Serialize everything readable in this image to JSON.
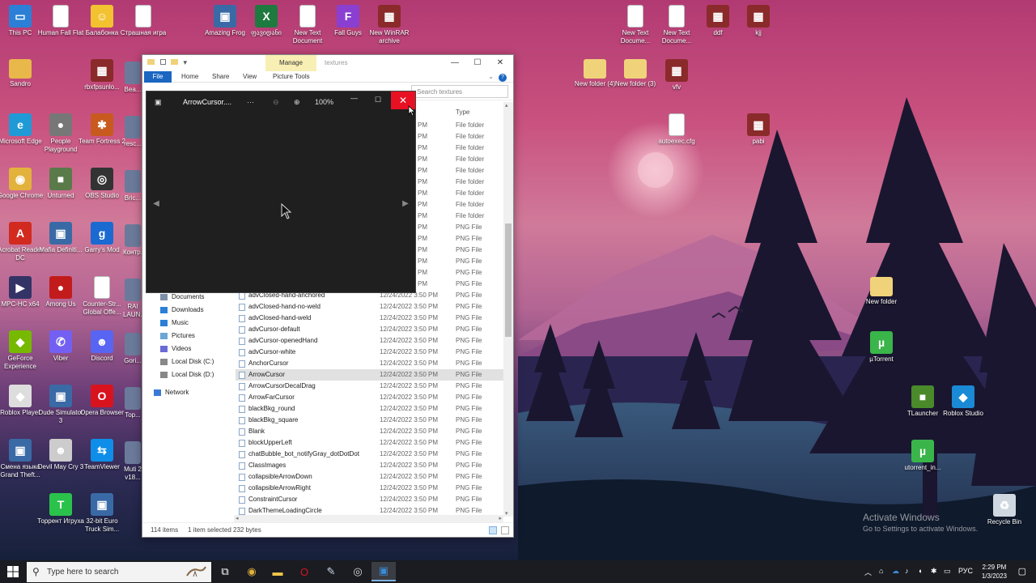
{
  "desktop": {
    "icons_left": [
      {
        "label": "This PC",
        "color": "#2b7fd6",
        "glyph": "▭"
      },
      {
        "label": "Human Fall Flat",
        "color": "#ffffff",
        "glyph": ""
      },
      {
        "label": "Балабонка",
        "color": "#f2c230",
        "glyph": "☺"
      },
      {
        "label": "Страшная игра",
        "color": "#ffffff",
        "glyph": ""
      },
      {
        "label": "Sandro",
        "color": "#e8b84a",
        "glyph": ""
      },
      {
        "label": "rbxfpsunlo...",
        "color": "#8a2a2a",
        "glyph": "▦"
      },
      {
        "label": "Microsoft Edge",
        "color": "#1f9ad6",
        "glyph": "e"
      },
      {
        "label": "People Playground",
        "color": "#777777",
        "glyph": "●"
      },
      {
        "label": "Team Fortress 2",
        "color": "#c85a1f",
        "glyph": "✱"
      },
      {
        "label": "Google Chrome",
        "color": "#e3b23c",
        "glyph": "◉"
      },
      {
        "label": "Unturned",
        "color": "#5a7a4a",
        "glyph": "■"
      },
      {
        "label": "OBS Studio",
        "color": "#333333",
        "glyph": "◎"
      },
      {
        "label": "Acrobat Reader DC",
        "color": "#d22a1f",
        "glyph": "A"
      },
      {
        "label": "Mafia Definiti...",
        "color": "#3a6aa6",
        "glyph": "▣"
      },
      {
        "label": "Garry's Mod",
        "color": "#1a6ad1",
        "glyph": "g"
      },
      {
        "label": "MPC-HC x64",
        "color": "#333366",
        "glyph": "▶"
      },
      {
        "label": "Among Us",
        "color": "#c21b1b",
        "glyph": "●"
      },
      {
        "label": "Counter-Str... Global Offe...",
        "color": "#ffffff",
        "glyph": ""
      },
      {
        "label": "GeForce Experience",
        "color": "#76b900",
        "glyph": "◆"
      },
      {
        "label": "Viber",
        "color": "#7360f2",
        "glyph": "✆"
      },
      {
        "label": "Discord",
        "color": "#5865f2",
        "glyph": "☻"
      },
      {
        "label": "Roblox Player",
        "color": "#dddddd",
        "glyph": "◆"
      },
      {
        "label": "Dude Simulator 3",
        "color": "#3a6aa6",
        "glyph": "▣"
      },
      {
        "label": "Opera Browser",
        "color": "#d8131e",
        "glyph": "O"
      },
      {
        "label": "Смена языка Grand Theft...",
        "color": "#3a6aa6",
        "glyph": "▣"
      },
      {
        "label": "Devil May Cry 3",
        "color": "#cccccc",
        "glyph": "☻"
      },
      {
        "label": "TeamViewer",
        "color": "#0e8ee9",
        "glyph": "⇆"
      },
      {
        "label": "Торрент Игруха",
        "color": "#2bc24c",
        "glyph": "T"
      },
      {
        "label": "32-bit Euro Truck Sim...",
        "color": "#3a6aa6",
        "glyph": "▣"
      }
    ],
    "icons_partial": [
      {
        "label": "Bea..."
      },
      {
        "label": "resc..."
      },
      {
        "label": "Bric..."
      },
      {
        "label": "Контр..."
      },
      {
        "label": "RAI LAUN..."
      },
      {
        "label": "Gori..."
      },
      {
        "label": "Top..."
      },
      {
        "label": "Muti 2 v18..."
      }
    ],
    "icons_top": [
      {
        "label": "Amazing Frog",
        "color": "#3a6aa6",
        "glyph": "▣"
      },
      {
        "label": "ფავიდანი",
        "color": "#1f7a3f",
        "glyph": "X"
      },
      {
        "label": "New Text Document",
        "color": "#ffffff",
        "glyph": ""
      },
      {
        "label": "Fall Guys",
        "color": "#8a3fd1",
        "glyph": "F"
      },
      {
        "label": "New WinRAR archive",
        "color": "#8a2a2a",
        "glyph": "▦"
      }
    ],
    "icons_right": [
      {
        "label": "New Text Docume...",
        "color": "#ffffff",
        "glyph": ""
      },
      {
        "label": "New Text Docume...",
        "color": "#ffffff",
        "glyph": ""
      },
      {
        "label": "ddf",
        "color": "#8a2a2a",
        "glyph": "▦"
      },
      {
        "label": "kjj",
        "color": "#8a2a2a",
        "glyph": "▦"
      },
      {
        "label": "New folder (4)",
        "color": "#f0d27a",
        "glyph": ""
      },
      {
        "label": "New folder (3)",
        "color": "#f0d27a",
        "glyph": ""
      },
      {
        "label": "vfv",
        "color": "#8a2a2a",
        "glyph": "▦"
      },
      {
        "label": "autoexec.cfg",
        "color": "#ffffff",
        "glyph": ""
      },
      {
        "label": "pabi",
        "color": "#8a2a2a",
        "glyph": "▦"
      },
      {
        "label": "New folder",
        "color": "#f0d27a",
        "glyph": ""
      },
      {
        "label": "µTorrent",
        "color": "#3ab54a",
        "glyph": "µ"
      },
      {
        "label": "TLauncher",
        "color": "#4a8a2a",
        "glyph": "■"
      },
      {
        "label": "Roblox Studio",
        "color": "#1a8ad6",
        "glyph": "◆"
      },
      {
        "label": "utorrent_in...",
        "color": "#3ab54a",
        "glyph": "µ"
      },
      {
        "label": "Recycle Bin",
        "color": "#cfd8e0",
        "glyph": "♻"
      }
    ]
  },
  "explorer": {
    "title": "textures",
    "manage_tab": "Manage",
    "picture_tools": "Picture Tools",
    "ribbon_tabs": [
      "File",
      "Home",
      "Share",
      "View"
    ],
    "search_placeholder": "Search textures",
    "column_type": "Type",
    "nav": [
      {
        "label": "Documents",
        "icon": "documents-icon"
      },
      {
        "label": "Downloads",
        "icon": "downloads-icon"
      },
      {
        "label": "Music",
        "icon": "music-icon"
      },
      {
        "label": "Pictures",
        "icon": "pictures-icon"
      },
      {
        "label": "Videos",
        "icon": "videos-icon"
      },
      {
        "label": "Local Disk (C:)",
        "icon": "drive-icon"
      },
      {
        "label": "Local Disk (D:)",
        "icon": "drive-icon"
      },
      {
        "label": "Network",
        "icon": "network-icon"
      }
    ],
    "hidden_rows": [
      {
        "date": "PM",
        "type": "File folder"
      },
      {
        "date": "PM",
        "type": "File folder"
      },
      {
        "date": "PM",
        "type": "File folder"
      },
      {
        "date": "PM",
        "type": "File folder"
      },
      {
        "date": "PM",
        "type": "File folder"
      },
      {
        "date": "PM",
        "type": "File folder"
      },
      {
        "date": "PM",
        "type": "File folder"
      },
      {
        "date": "PM",
        "type": "File folder"
      },
      {
        "date": "PM",
        "type": "File folder"
      },
      {
        "date": "PM",
        "type": "PNG File"
      },
      {
        "date": "PM",
        "type": "PNG File"
      },
      {
        "date": "PM",
        "type": "PNG File"
      },
      {
        "date": "PM",
        "type": "PNG File"
      },
      {
        "date": "PM",
        "type": "PNG File"
      },
      {
        "date": "PM",
        "type": "PNG File"
      }
    ],
    "files": [
      {
        "name": "advClosed-hand-anchored",
        "date": "12/24/2022 3:50 PM",
        "type": "PNG File"
      },
      {
        "name": "advClosed-hand-no-weld",
        "date": "12/24/2022 3:50 PM",
        "type": "PNG File"
      },
      {
        "name": "advClosed-hand-weld",
        "date": "12/24/2022 3:50 PM",
        "type": "PNG File"
      },
      {
        "name": "advCursor-default",
        "date": "12/24/2022 3:50 PM",
        "type": "PNG File"
      },
      {
        "name": "advCursor-openedHand",
        "date": "12/24/2022 3:50 PM",
        "type": "PNG File"
      },
      {
        "name": "advCursor-white",
        "date": "12/24/2022 3:50 PM",
        "type": "PNG File"
      },
      {
        "name": "AnchorCursor",
        "date": "12/24/2022 3:50 PM",
        "type": "PNG File"
      },
      {
        "name": "ArrowCursor",
        "date": "12/24/2022 3:50 PM",
        "type": "PNG File",
        "selected": true
      },
      {
        "name": "ArrowCursorDecalDrag",
        "date": "12/24/2022 3:50 PM",
        "type": "PNG File"
      },
      {
        "name": "ArrowFarCursor",
        "date": "12/24/2022 3:50 PM",
        "type": "PNG File"
      },
      {
        "name": "blackBkg_round",
        "date": "12/24/2022 3:50 PM",
        "type": "PNG File"
      },
      {
        "name": "blackBkg_square",
        "date": "12/24/2022 3:50 PM",
        "type": "PNG File"
      },
      {
        "name": "Blank",
        "date": "12/24/2022 3:50 PM",
        "type": "PNG File"
      },
      {
        "name": "blockUpperLeft",
        "date": "12/24/2022 3:50 PM",
        "type": "PNG File"
      },
      {
        "name": "chatBubble_bot_notifyGray_dotDotDot",
        "date": "12/24/2022 3:50 PM",
        "type": "PNG File"
      },
      {
        "name": "ClassImages",
        "date": "12/24/2022 3:50 PM",
        "type": "PNG File"
      },
      {
        "name": "collapsibleArrowDown",
        "date": "12/24/2022 3:50 PM",
        "type": "PNG File"
      },
      {
        "name": "collapsibleArrowRight",
        "date": "12/24/2022 3:50 PM",
        "type": "PNG File"
      },
      {
        "name": "ConstraintCursor",
        "date": "12/24/2022 3:50 PM",
        "type": "PNG File"
      },
      {
        "name": "DarkThemeLoadingCircle",
        "date": "12/24/2022 3:50 PM",
        "type": "PNG File"
      }
    ],
    "status": {
      "count": "114 items",
      "selected": "1 item selected  232 bytes"
    }
  },
  "viewer": {
    "filename": "ArrowCursor....",
    "more": "···",
    "zoom": "100%",
    "close_glyph": "✕",
    "minimize_glyph": "—",
    "maximize_glyph": "☐"
  },
  "watermark": {
    "title": "Activate Windows",
    "subtitle": "Go to Settings to activate Windows."
  },
  "taskbar": {
    "search_placeholder": "Type here to search",
    "apps": [
      "task-view-icon",
      "chrome-icon",
      "file-explorer-icon",
      "opera-icon",
      "paint-icon",
      "obs-icon",
      "photos-icon"
    ],
    "language": "РУС",
    "time": "2:29 PM",
    "date": "1/3/2023"
  }
}
